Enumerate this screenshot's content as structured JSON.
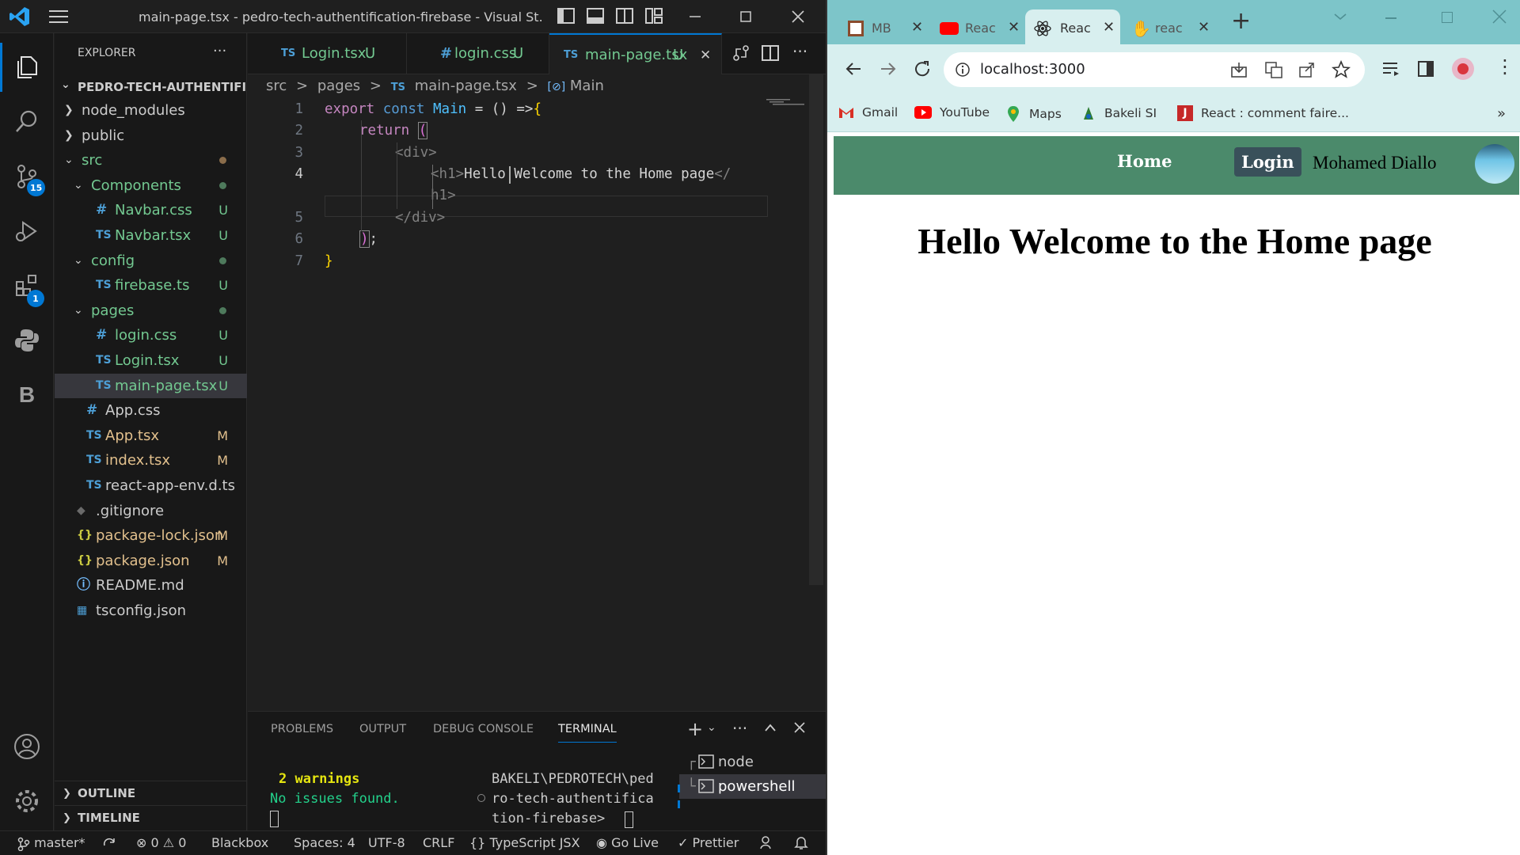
{
  "vscode": {
    "title": "main-page.tsx - pedro-tech-authentification-firebase - Visual St...",
    "activity_badges": {
      "source_control": "15",
      "extensions": "1"
    },
    "explorer": {
      "header": "EXPLORER",
      "more": "···",
      "root": "PEDRO-TECH-AUTHENTIFI...",
      "items": [
        {
          "label": "node_modules",
          "kind": "folder",
          "status": ""
        },
        {
          "label": "public",
          "kind": "folder",
          "status": ""
        },
        {
          "label": "src",
          "kind": "folder-open",
          "status": ""
        },
        {
          "label": "Components",
          "kind": "folder-open",
          "status": ""
        },
        {
          "label": "Navbar.css",
          "kind": "css",
          "status": "U"
        },
        {
          "label": "Navbar.tsx",
          "kind": "ts",
          "status": "U"
        },
        {
          "label": "config",
          "kind": "folder-open",
          "status": ""
        },
        {
          "label": "firebase.ts",
          "kind": "ts",
          "status": "U"
        },
        {
          "label": "pages",
          "kind": "folder-open",
          "status": ""
        },
        {
          "label": "login.css",
          "kind": "css",
          "status": "U"
        },
        {
          "label": "Login.tsx",
          "kind": "ts",
          "status": "U"
        },
        {
          "label": "main-page.tsx",
          "kind": "ts",
          "status": "U"
        },
        {
          "label": "App.css",
          "kind": "css",
          "status": ""
        },
        {
          "label": "App.tsx",
          "kind": "ts",
          "status": "M"
        },
        {
          "label": "index.tsx",
          "kind": "ts",
          "status": "M"
        },
        {
          "label": "react-app-env.d.ts",
          "kind": "ts",
          "status": ""
        },
        {
          "label": ".gitignore",
          "kind": "git",
          "status": ""
        },
        {
          "label": "package-lock.json",
          "kind": "json",
          "status": "M"
        },
        {
          "label": "package.json",
          "kind": "json",
          "status": "M"
        },
        {
          "label": "README.md",
          "kind": "info",
          "status": ""
        },
        {
          "label": "tsconfig.json",
          "kind": "tsconfig",
          "status": ""
        }
      ],
      "outline": "OUTLINE",
      "timeline": "TIMELINE"
    },
    "tabs": [
      {
        "icon": "TS",
        "label": "Login.tsx",
        "status": "U"
      },
      {
        "icon": "#",
        "label": "login.css",
        "status": "U"
      },
      {
        "icon": "TS",
        "label": "main-page.tsx",
        "status": "U",
        "close": "✕"
      }
    ],
    "breadcrumb": {
      "p1": "src",
      "p2": "pages",
      "icon": "TS",
      "p3": "main-page.tsx",
      "p4": "Main",
      "sep": ">"
    },
    "code": {
      "line_numbers": [
        "1",
        "2",
        "3",
        "4",
        "",
        "5",
        "6",
        "7"
      ],
      "l1_kw": "export",
      "l1_kw2": "const",
      "l1_name": "Main",
      "l1_rest": " = () =>",
      "l1_brace": "{",
      "l2_kw": "return",
      "l2_paren": "(",
      "l3_tag": "<div>",
      "l4_tag": "<h1>",
      "l4_text": "Hello Welcome to the Home page",
      "l4_end": "</",
      "l4b": "h1>",
      "l5_tag": "</div>",
      "l6_paren": ")",
      "l6_semi": ";",
      "l7_brace": "}"
    },
    "panel": {
      "tabs": [
        "PROBLEMS",
        "OUTPUT",
        "DEBUG CONSOLE",
        "TERMINAL"
      ],
      "warnings": "2 warnings",
      "no_issues": "No issues found.",
      "prompt_lines": [
        "BAKELI\\PEDROTECH\\ped",
        "ro-tech-authentifica",
        "tion-firebase>"
      ],
      "terminals": [
        "node",
        "powershell"
      ]
    },
    "status": {
      "branch": "master*",
      "errors": "0",
      "warnings": "0",
      "blackbox": "Blackbox",
      "spaces": "Spaces: 4",
      "encoding": "UTF-8",
      "eol": "CRLF",
      "language": "TypeScript JSX",
      "golive": "Go Live",
      "prettier": "Prettier"
    }
  },
  "browser": {
    "tabs": [
      {
        "label": "MB",
        "icon": "mb"
      },
      {
        "label": "Reac",
        "icon": "youtube"
      },
      {
        "label": "Reac",
        "icon": "react"
      },
      {
        "label": "reac",
        "icon": "hand"
      }
    ],
    "new_tab": "+",
    "url": "localhost:3000",
    "bookmarks": [
      "Gmail",
      "YouTube",
      "Maps",
      "Bakeli SI",
      "React : comment faire..."
    ],
    "bookmarks_more": "»",
    "app": {
      "nav_home": "Home",
      "nav_login": "Login",
      "user_name": "Mohamed Diallo",
      "heading": "Hello Welcome to the Home page"
    }
  }
}
